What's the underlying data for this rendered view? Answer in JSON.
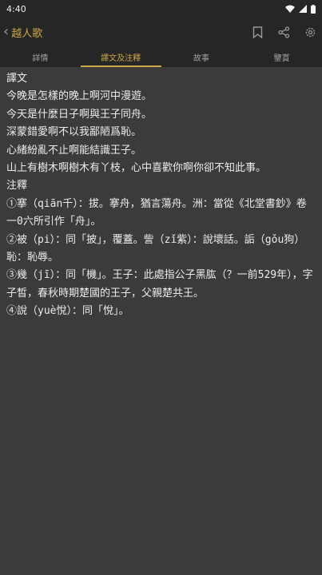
{
  "status": {
    "time": "4:40"
  },
  "header": {
    "back_icon": "chevron-left-icon",
    "title": "越人歌",
    "icons": [
      "bookmark-icon",
      "share-icon",
      "settings-icon"
    ]
  },
  "tabs": [
    {
      "label": "詳情",
      "active": false
    },
    {
      "label": "譯文及注釋",
      "active": true
    },
    {
      "label": "故事",
      "active": false
    },
    {
      "label": "鑒賞",
      "active": false
    }
  ],
  "content": {
    "translation_heading": "譯文",
    "translation": [
      "今晚是怎樣的晚上啊河中漫遊。",
      "今天是什麼日子啊與王子同舟。",
      "深蒙錯愛啊不以我鄙陋爲恥。",
      "心緒紛亂不止啊能結識王子。",
      "山上有樹木啊樹木有丫枝，心中喜歡你啊你卻不知此事。"
    ],
    "notes_heading": "注釋",
    "notes": [
      "①搴（qiān千）：拔。搴舟，猶言蕩舟。洲：當從《北堂書鈔》卷一0六所引作「舟」。",
      "②被（pi）：同「披」，覆蓋。訾（zǐ紫）：說壞話。詬（gǒu狗）恥：恥辱。",
      "③幾（jī）：同「機」。王子：此處指公子黑肱（？一前529年），字子皙，春秋時期楚國的王子，父親楚共王。",
      "④說（yuè悅）：同「悅」。"
    ]
  },
  "colors": {
    "accent": "#c9a646",
    "background": "#3b3b3b",
    "bar": "#262626"
  }
}
